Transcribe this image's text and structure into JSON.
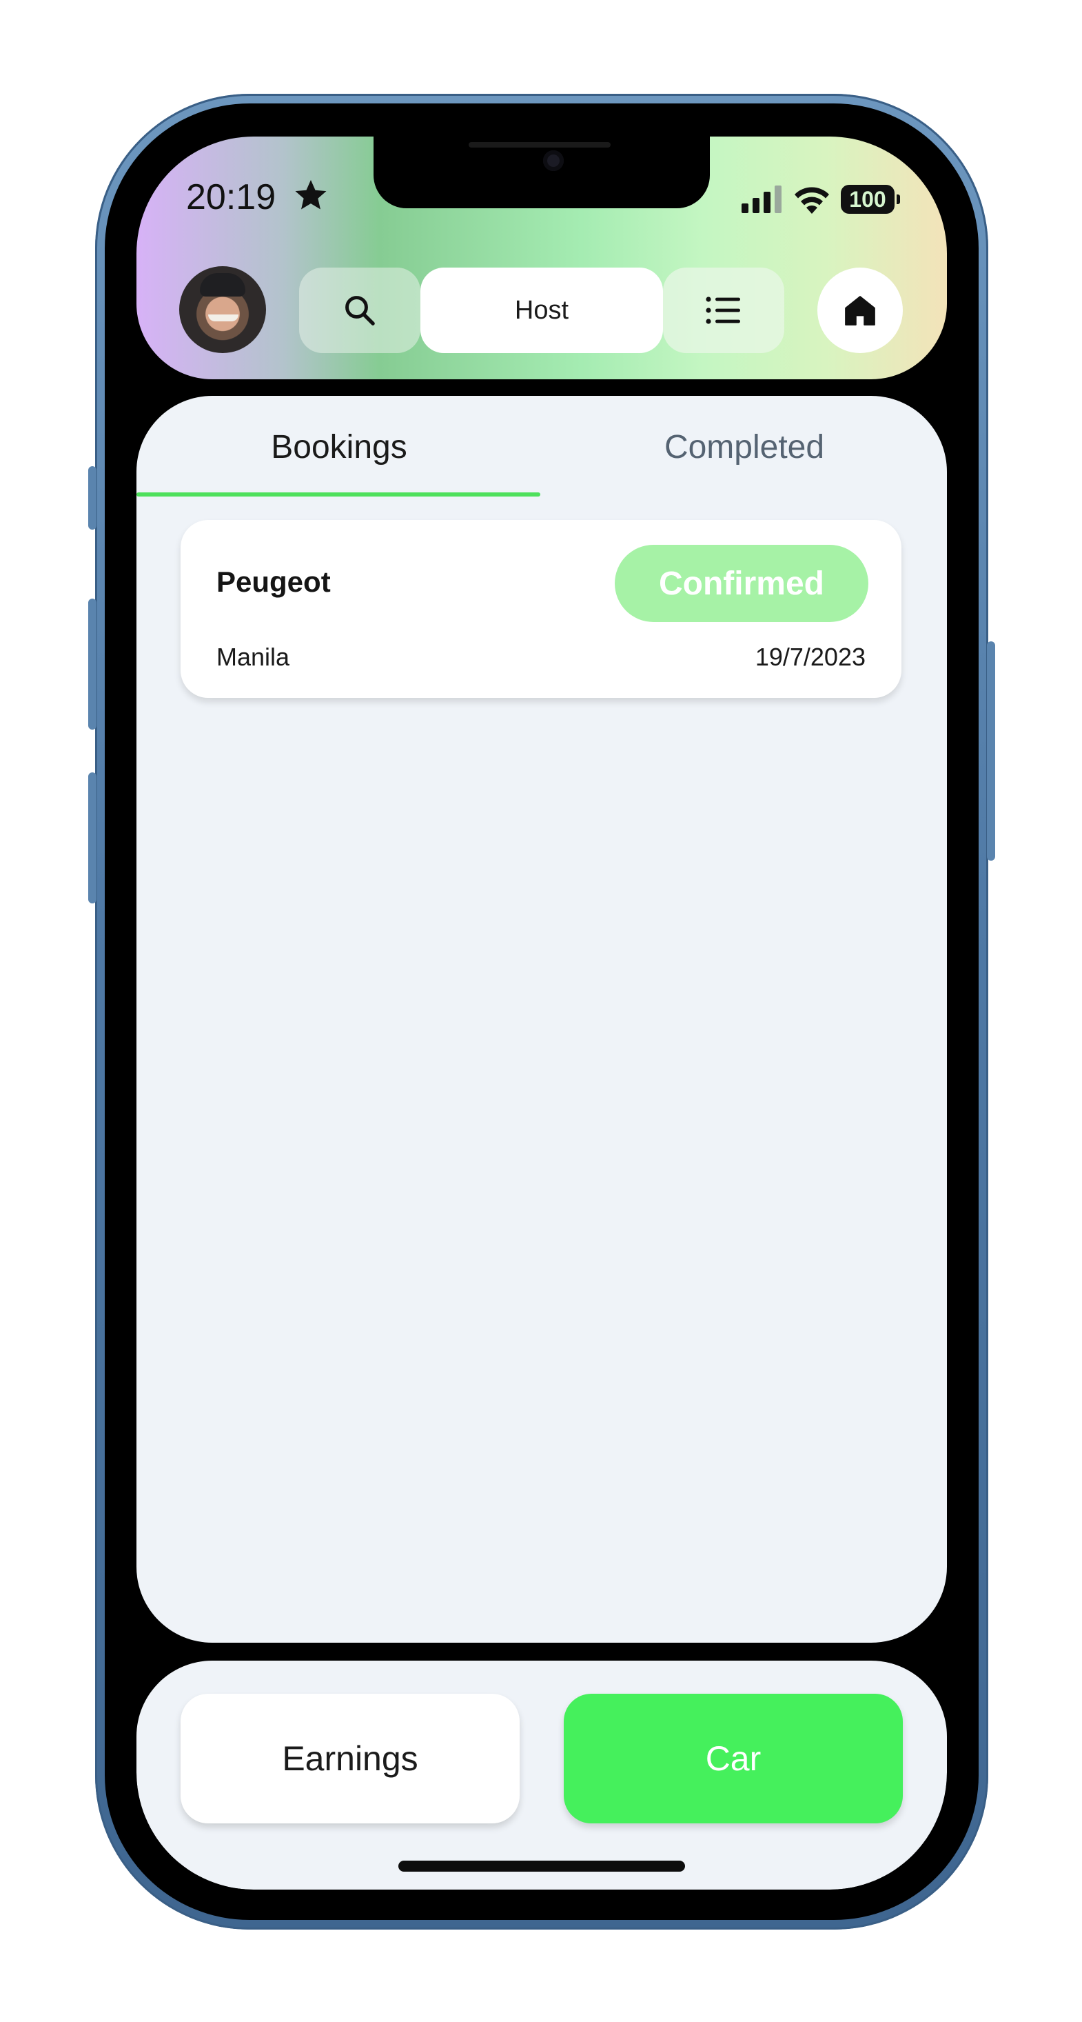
{
  "status_bar": {
    "time": "20:19",
    "battery": "100"
  },
  "header": {
    "nav_pills": {
      "search_icon": "search-icon",
      "host_label": "Host",
      "menu_icon": "list-icon"
    },
    "home_icon": "home-icon"
  },
  "tabs": [
    {
      "label": "Bookings",
      "active": true
    },
    {
      "label": "Completed",
      "active": false
    }
  ],
  "bookings": [
    {
      "car": "Peugeot",
      "status": "Confirmed",
      "location": "Manila",
      "date": "19/7/2023"
    }
  ],
  "bottom_nav": {
    "earnings_label": "Earnings",
    "car_label": "Car"
  },
  "colors": {
    "accent_green": "#45f05c",
    "badge_green": "#a6f2a6",
    "tab_underline": "#4ee05c",
    "card_bg": "#eff3f8"
  }
}
